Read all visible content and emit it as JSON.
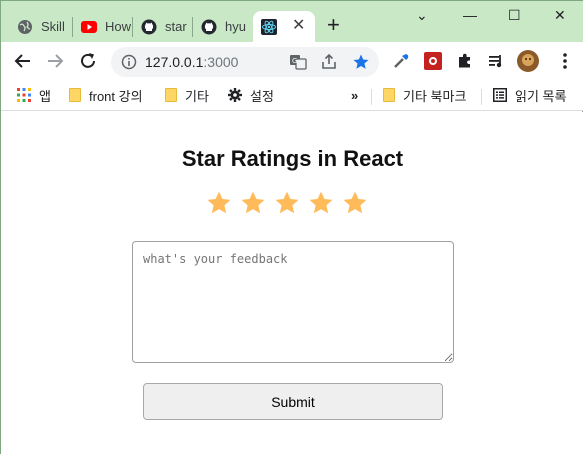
{
  "browser": {
    "tabs": [
      {
        "label": "Skill",
        "icon": "globe-icon"
      },
      {
        "label": "How",
        "icon": "youtube-icon"
      },
      {
        "label": "star",
        "icon": "github-icon"
      },
      {
        "label": "hyu",
        "icon": "github-icon"
      },
      {
        "label": "",
        "icon": "react-icon",
        "active": true
      }
    ],
    "new_tab_symbol": "+",
    "close_symbol": "✕",
    "window_controls": {
      "minimize": "—",
      "maximize": "☐",
      "close": "✕",
      "dropdown": "⌄"
    },
    "url_host": "127.0.0.1",
    "url_port": ":3000"
  },
  "bookmarks": {
    "apps_label": "앱",
    "items": [
      {
        "label": "front 강의",
        "icon": "folder-icon"
      },
      {
        "label": "기타",
        "icon": "folder-icon"
      },
      {
        "label": "설정",
        "icon": "gear-icon"
      }
    ],
    "overflow": "»",
    "other_label": "기타 북마크",
    "reading_list_label": "읽기 목록"
  },
  "app": {
    "title": "Star Ratings in React",
    "rating_max": 5,
    "rating_value": 5,
    "star_color": "#ffba5a",
    "feedback_placeholder": "what's your feedback",
    "feedback_value": "",
    "submit_label": "Submit"
  }
}
